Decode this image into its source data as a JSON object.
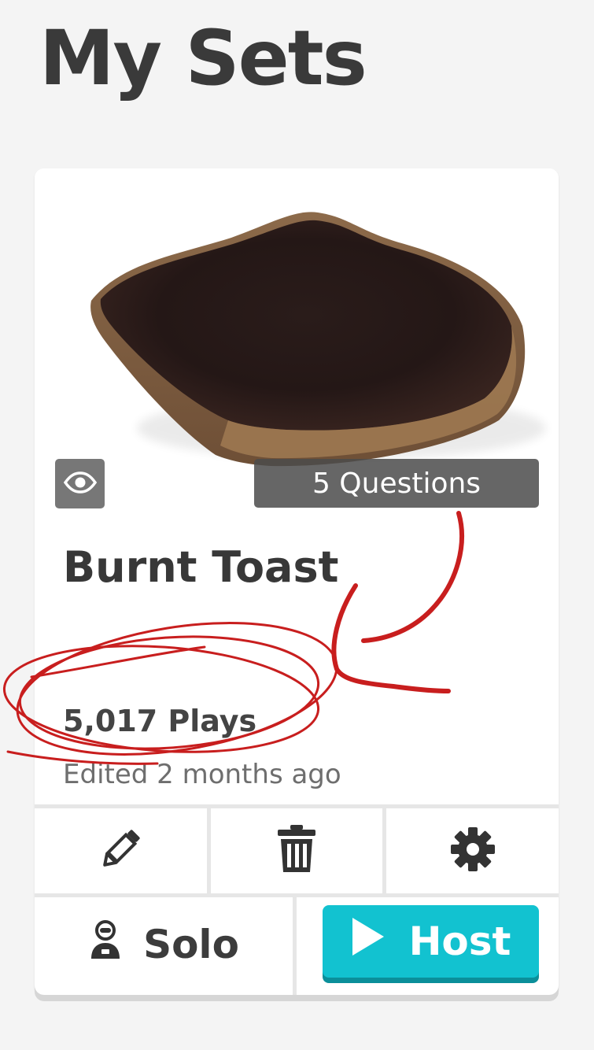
{
  "page": {
    "title": "My Sets"
  },
  "set_card": {
    "image": "burnt-toast-photo",
    "questions_label": "5 Questions",
    "title": "Burnt Toast",
    "plays_label": "5,017 Plays",
    "edited_label": "Edited 2 months ago",
    "actions": {
      "edit_icon": "pencil-icon",
      "delete_icon": "trash-icon",
      "settings_icon": "gear-icon"
    },
    "solo_label": "Solo",
    "host_label": "Host"
  },
  "colors": {
    "host_button": "#12c2d0",
    "host_button_shadow": "#0b8f9a",
    "annotation_ink": "#c81e1e",
    "badge_bg": "#777777"
  }
}
